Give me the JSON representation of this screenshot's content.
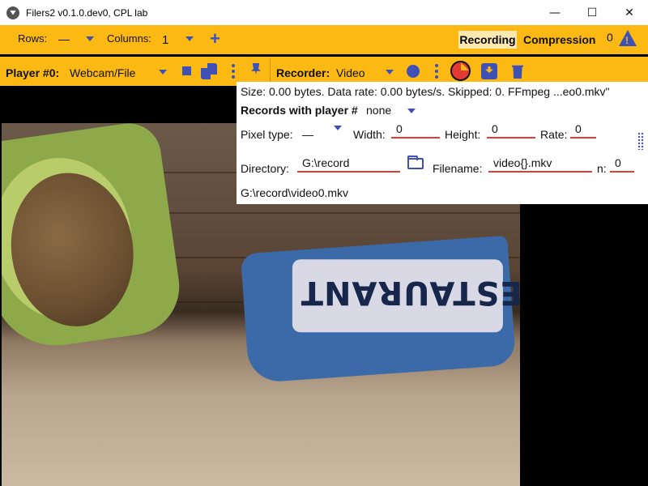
{
  "window": {
    "title": "Filers2 v0.1.0.dev0, CPL lab",
    "min": "—",
    "max": "☐",
    "close": "✕"
  },
  "toolbar": {
    "rows_label": "Rows:",
    "rows_value": "—",
    "columns_label": "Columns:",
    "columns_value": "1",
    "recording": "Recording",
    "compression": "Compression",
    "error_count": "0"
  },
  "player_bar": {
    "player_label": "Player #0:",
    "player_source": "Webcam/File",
    "recorder_label": "Recorder:",
    "recorder_type": "Video"
  },
  "panel": {
    "status": "Size: 0.00 bytes. Data rate: 0.00 bytes/s. Skipped: 0. FFmpeg ...eo0.mkv\"",
    "records_label": "Records with player #",
    "records_value": "none",
    "pixel_type_label": "Pixel type:",
    "pixel_type_value": "—",
    "width_label": "Width:",
    "width_value": "0",
    "height_label": "Height:",
    "height_value": "0",
    "rate_label": "Rate:",
    "rate_value": "0",
    "directory_label": "Directory:",
    "directory_value": "G:\\record",
    "filename_label": "Filename:",
    "filename_value": "video{}.mkv",
    "n_label": "n:",
    "n_value": "0",
    "full_path": "G:\\record\\video0.mkv"
  },
  "video": {
    "bag_text": "RESTAURANT"
  },
  "colors": {
    "accent": "#3f51b5",
    "bar": "#fdb913",
    "record_red": "#e53935"
  }
}
